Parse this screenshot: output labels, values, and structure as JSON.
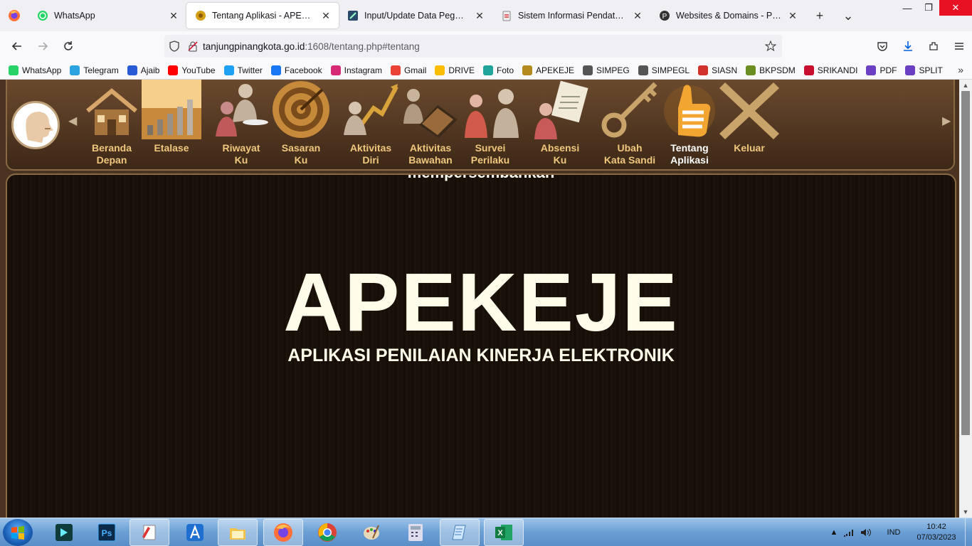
{
  "browser": {
    "tabs": [
      {
        "title": "WhatsApp",
        "icon": "whatsapp-icon",
        "active": false
      },
      {
        "title": "Tentang Aplikasi - APEKEJE",
        "icon": "apekeje-icon",
        "active": true
      },
      {
        "title": "Input/Update Data Pegawai",
        "icon": "pegawai-icon",
        "active": false
      },
      {
        "title": "Sistem Informasi Pendataan Aplikasi",
        "icon": "clipboard-icon",
        "active": false
      },
      {
        "title": "Websites & Domains - Plesk Obsidian",
        "icon": "plesk-icon",
        "active": false
      }
    ],
    "url": {
      "host": "tanjungpinangkota.go.id",
      "rest": ":1608/tentang.php#tentang"
    },
    "bookmarks": [
      {
        "label": "WhatsApp",
        "color": "#25d366"
      },
      {
        "label": "Telegram",
        "color": "#2aa3e0"
      },
      {
        "label": "Ajaib",
        "color": "#2a5bd7"
      },
      {
        "label": "YouTube",
        "color": "#ff0000"
      },
      {
        "label": "Twitter",
        "color": "#1da1f2"
      },
      {
        "label": "Facebook",
        "color": "#1877f2"
      },
      {
        "label": "Instagram",
        "color": "#d62976"
      },
      {
        "label": "Gmail",
        "color": "#ea4335"
      },
      {
        "label": "DRIVE",
        "color": "#fbbc04"
      },
      {
        "label": "Foto",
        "color": "#1fa39b"
      },
      {
        "label": "APEKEJE",
        "color": "#b48a1e"
      },
      {
        "label": "SIMPEG",
        "color": "#555555"
      },
      {
        "label": "SIMPEGL",
        "color": "#555555"
      },
      {
        "label": "SIASN",
        "color": "#d0312d"
      },
      {
        "label": "BKPSDM",
        "color": "#6b8e23"
      },
      {
        "label": "SRIKANDI",
        "color": "#c8102e"
      },
      {
        "label": "PDF",
        "color": "#6a3fc1"
      },
      {
        "label": "SPLIT",
        "color": "#6a3fc1"
      }
    ]
  },
  "app": {
    "menu": [
      {
        "label": "Beranda\nDepan",
        "icon": "house-icon"
      },
      {
        "label": "Etalase",
        "icon": "chart-icon"
      },
      {
        "label": "Riwayat\nKu",
        "icon": "history-icon"
      },
      {
        "label": "Sasaran\nKu",
        "icon": "target-icon"
      },
      {
        "label": "Aktivitas\nDiri",
        "icon": "growth-icon"
      },
      {
        "label": "Aktivitas\nBawahan",
        "icon": "team-icon"
      },
      {
        "label": "Survei\nPerilaku",
        "icon": "survey-icon"
      },
      {
        "label": "Absensi\nKu",
        "icon": "attendance-icon"
      },
      {
        "label": "Ubah\nKata Sandi",
        "icon": "key-icon"
      },
      {
        "label": "Tentang\nAplikasi",
        "icon": "thumbs-up-icon",
        "active": true
      },
      {
        "label": "Keluar",
        "icon": "x-icon"
      }
    ],
    "scrolling_text": "mempersembahkan",
    "title": "APEKEJE",
    "subtitle": "APLIKASI PENILAIAN KINERJA ELEKTRONIK"
  },
  "taskbar": {
    "language": "IND",
    "time": "10:42",
    "date": "07/03/2023"
  }
}
